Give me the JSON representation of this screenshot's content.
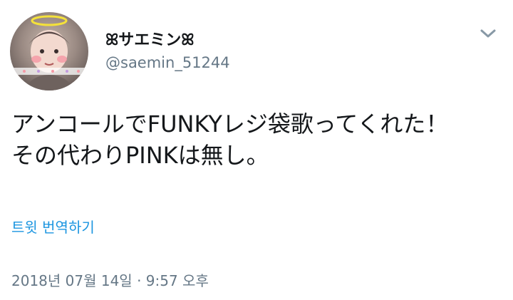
{
  "user": {
    "display_name": "ꕤサエミンꕤ",
    "handle": "@saemin_51244"
  },
  "tweet": {
    "text": "アンコールでFUNKYレジ袋歌ってくれた！\nその代わりPINKは無し。",
    "translate_label": "트윗 번역하기",
    "timestamp": "2018년 07월 14일 · 9:57 오후"
  },
  "icons": {
    "avatar": "profile-photo",
    "menu": "chevron-down-icon"
  },
  "colors": {
    "text": "#14171a",
    "secondary": "#657786",
    "link": "#1b95e0"
  }
}
